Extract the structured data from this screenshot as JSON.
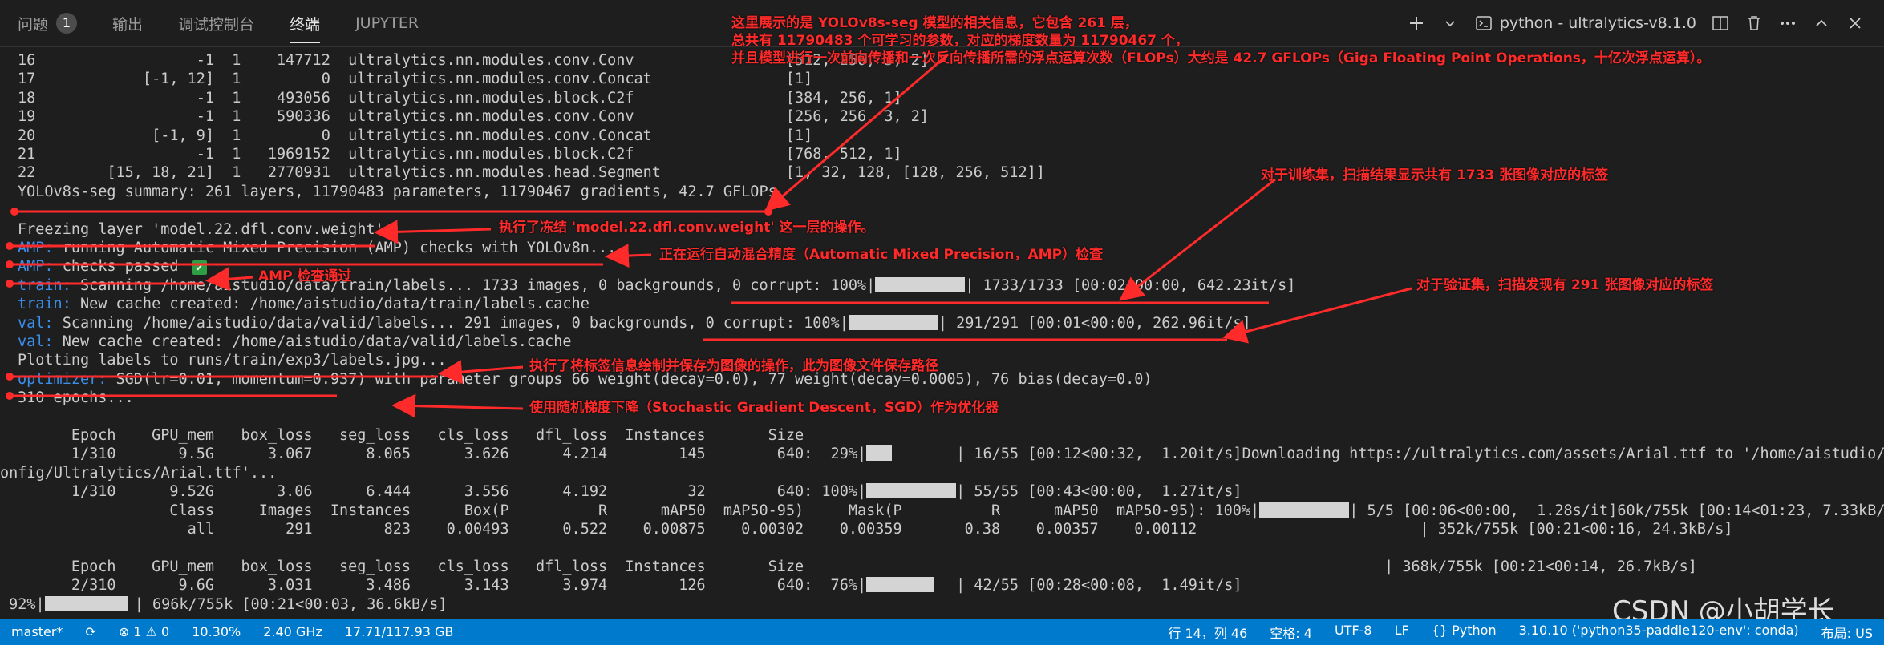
{
  "panel_tabs": [
    {
      "label": "问题",
      "count": "1"
    },
    {
      "label": "输出"
    },
    {
      "label": "调试控制台"
    },
    {
      "label": "终端"
    },
    {
      "label": "JUPYTER"
    }
  ],
  "terminal_selector": "python - ultralytics-v8.1.0",
  "terminal_lines": [
    {
      "text": "16                  -1  1    147712  ultralytics.nn.modules.conv.Conv                 [512, 256, 3, 2]"
    },
    {
      "text": "17            [-1, 12]  1         0  ultralytics.nn.modules.conv.Concat               [1]"
    },
    {
      "text": "18                  -1  1    493056  ultralytics.nn.modules.block.C2f                 [384, 256, 1]"
    },
    {
      "text": "19                  -1  1    590336  ultralytics.nn.modules.conv.Conv                 [256, 256, 3, 2]"
    },
    {
      "text": "20             [-1, 9]  1         0  ultralytics.nn.modules.conv.Concat               [1]"
    },
    {
      "text": "21                  -1  1   1969152  ultralytics.nn.modules.block.C2f                 [768, 512, 1]"
    },
    {
      "text": "22        [15, 18, 21]  1   2770931  ultralytics.nn.modules.head.Segment              [1, 32, 128, [128, 256, 512]]"
    },
    {
      "text": "YOLOv8s-seg summary: 261 layers, 11790483 parameters, 11790467 gradients, 42.7 GFLOPs"
    },
    {
      "text": ""
    },
    {
      "text": "Freezing layer 'model.22.dfl.conv.weight'"
    },
    {
      "prefix": "AMP:",
      "text": " running Automatic Mixed Precision (AMP) checks with YOLOv8n..."
    },
    {
      "prefix": "AMP:",
      "text": " checks passed ",
      "checkmark": "✔"
    },
    {
      "prefix": "train:",
      "text": " Scanning /home/aistudio/data/train/labels... 1733 images, 0 backgrounds, 0 corrupt: 100%|",
      "bar_fraction": 1.0,
      "suffix": "| 1733/1733 [00:02<00:00, 642.23it/s]"
    },
    {
      "prefix": "train:",
      "text": " New cache created: /home/aistudio/data/train/labels.cache"
    },
    {
      "prefix": "val:",
      "text": " Scanning /home/aistudio/data/valid/labels... 291 images, 0 backgrounds, 0 corrupt: 100%|",
      "bar_fraction": 1.0,
      "suffix": "| 291/291 [00:01<00:00, 262.96it/s]"
    },
    {
      "prefix": "val:",
      "text": " New cache created: /home/aistudio/data/valid/labels.cache"
    },
    {
      "text": "Plotting labels to runs/train/exp3/labels.jpg..."
    },
    {
      "prefix": "optimizer:",
      "text": " SGD(lr=0.01, momentum=0.937) with parameter groups 66 weight(decay=0.0), 77 weight(decay=0.0005), 76 bias(decay=0.0)"
    },
    {
      "text": "310 epochs..."
    },
    {
      "text": ""
    },
    {
      "text": "      Epoch    GPU_mem   box_loss   seg_loss   cls_loss   dfl_loss  Instances       Size"
    },
    {
      "text": "      1/310       9.5G      3.067      8.065      3.626      4.214        145        640:  29%|",
      "bar_fraction": 0.29,
      "suffix": "| 16/55 [00:12<00:32,  1.20it/s]Downloading https://ultralytics.com/assets/Arial.ttf to '/home/aistudio/.c"
    },
    {
      "text": "onfig/Ultralytics/Arial.ttf'...",
      "cont": true
    },
    {
      "text": "      1/310      9.52G       3.06      6.444      3.556      4.192         32        640: 100%|",
      "bar_fraction": 1.0,
      "suffix": "| 55/55 [00:43<00:00,  1.27it/s]"
    },
    {
      "text": "                 Class     Images  Instances      Box(P          R      mAP50  mAP50-95)     Mask(P          R      mAP50  mAP50-95): 100%|",
      "bar_fraction": 1.0,
      "suffix": "| 5/5 [00:06<00:00,  1.28s/it]60k/755k [00:14<01:23, 7.33kB/s]"
    },
    {
      "text": "                   all        291        823    0.00493      0.522    0.00875    0.00302    0.00359       0.38    0.00357    0.00112                         | 352k/755k [00:21<00:16, 24.3kB/s]"
    },
    {
      "text": ""
    },
    {
      "text": "      Epoch    GPU_mem   box_loss   seg_loss   cls_loss   dfl_loss  Instances       Size                                                                 | 368k/755k [00:21<00:14, 26.7kB/s]"
    },
    {
      "text": "      2/310       9.6G      3.031      3.486      3.143      3.974        126        640:  76%|",
      "bar_fraction": 0.76,
      "suffix": "| 42/55 [00:28<00:08,  1.49it/s]"
    },
    {
      "text": " 92%|",
      "cont": true,
      "bar_fraction": 0.92,
      "suffix": "| 696k/755k [00:21<00:03, 36.6kB/s]"
    }
  ],
  "annotations": [
    {
      "text": "这里展示的是 YOLOv8s-seg 模型的相关信息，它包含 261 层，\n总共有 11790483 个可学习的参数，对应的梯度数量为 11790467 个，\n并且模型进行一次前向传播和一次反向传播所需的浮点运算次数（FLOPs）大约是 42.7 GFLOPs（Giga Floating Point Operations，十亿次浮点运算）。"
    },
    {
      "text": "对于训练集，扫描结果显示共有 1733 张图像对应的标签"
    },
    {
      "text": "执行了冻结 'model.22.dfl.conv.weight' 这一层的操作。"
    },
    {
      "text": "正在运行自动混合精度（Automatic Mixed Precision，AMP）检查"
    },
    {
      "text": "AMP 检查通过"
    },
    {
      "text": "对于验证集，扫描发现有 291 张图像对应的标签"
    },
    {
      "text": "执行了将标签信息绘制并保存为图像的操作，此为图像文件保存路径"
    },
    {
      "text": "使用随机梯度下降（Stochastic Gradient Descent，SGD）作为优化器"
    }
  ],
  "status_bar": {
    "left": [
      "master*",
      "⊗ 1 ⚠ 0",
      "10.30%",
      "2.40 GHz",
      "17.71/117.93 GB"
    ],
    "right": [
      "行 14，列 46",
      "空格: 4",
      "UTF-8",
      "LF",
      "{} Python",
      "3.10.10 ('python35-paddle120-env': conda)",
      "布局: US"
    ]
  },
  "watermark": "CSDN @小胡学长",
  "colors": {
    "terminal_bg": "#1e1e1e",
    "prefix_blue": "#3b8eea",
    "annotation_red": "#ff2a2a",
    "statusbar_bg": "#007acc"
  }
}
